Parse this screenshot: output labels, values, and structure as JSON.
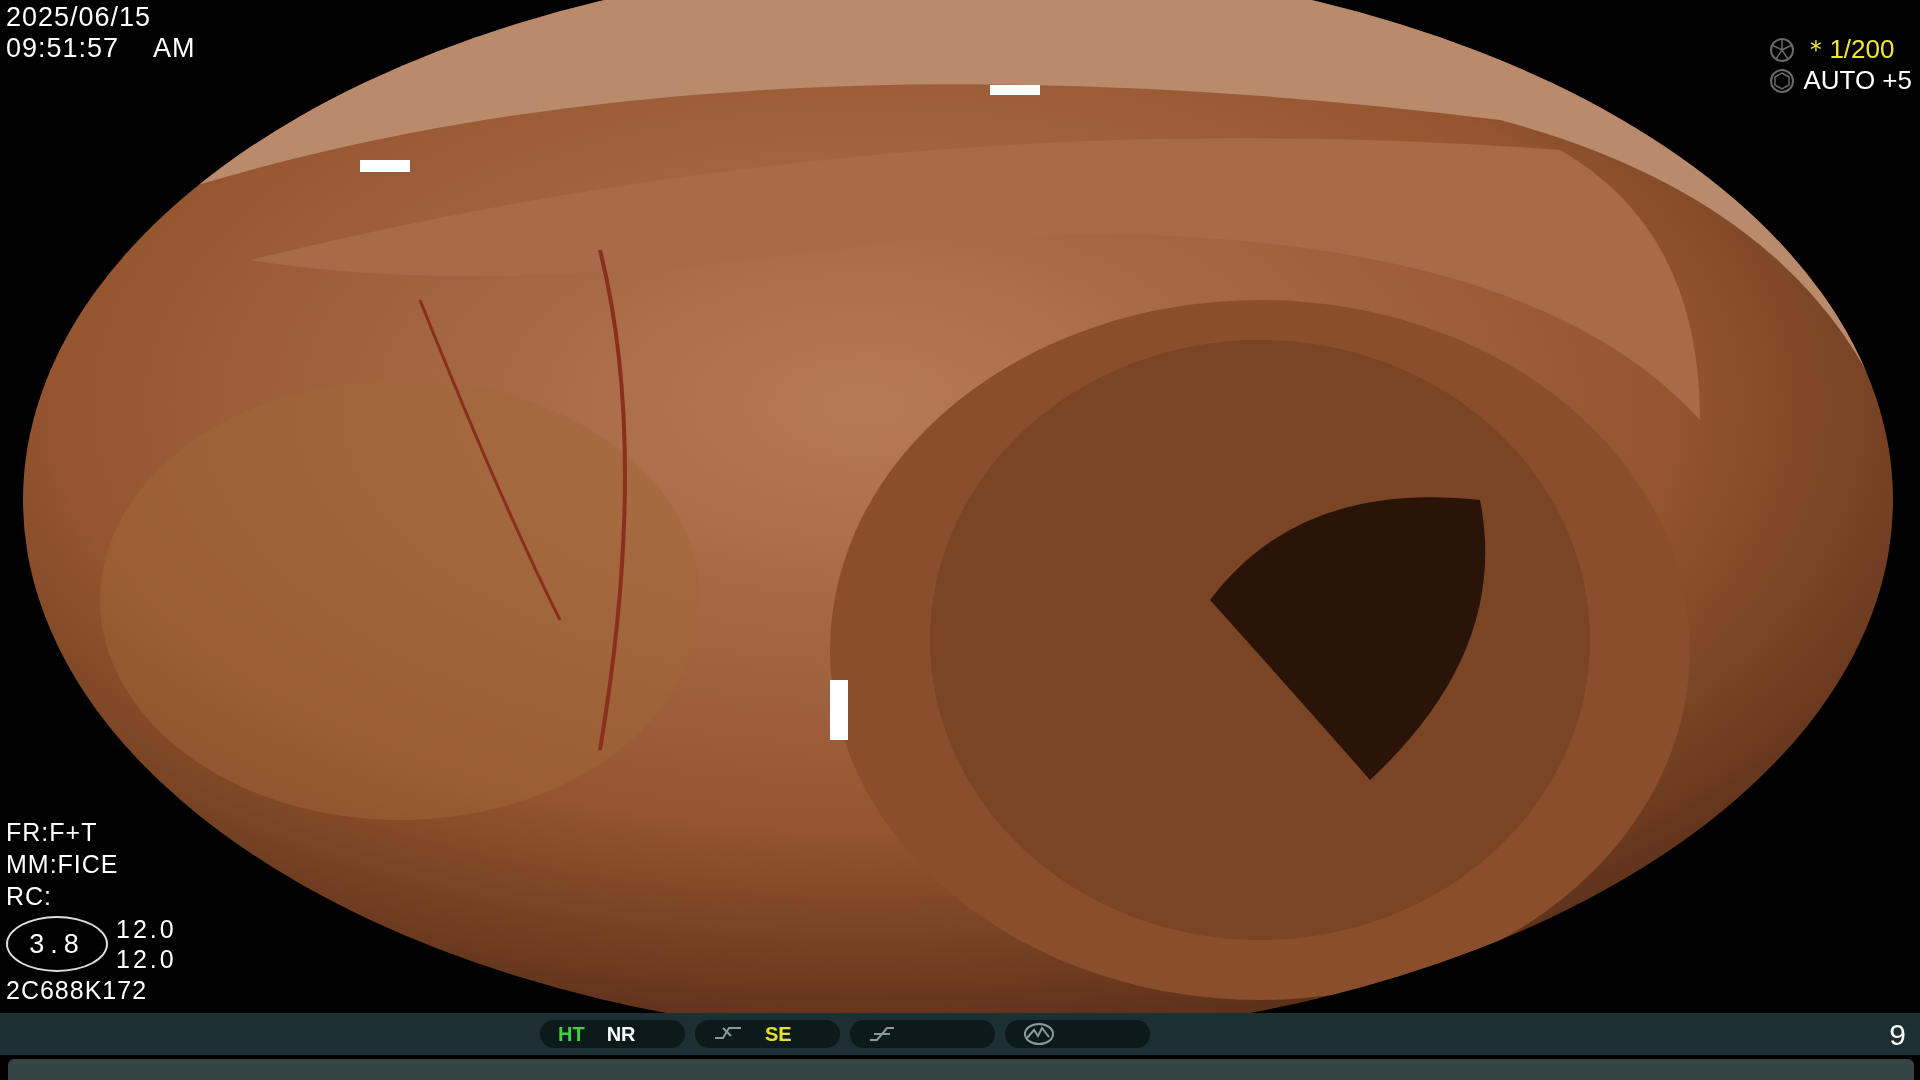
{
  "top_left": {
    "date": "2025/06/15",
    "time": "09:51:57",
    "meridiem": "AM"
  },
  "top_right": {
    "shutter_mark": "＊",
    "shutter": "1/200",
    "exposure": "AUTO +5"
  },
  "bottom_left": {
    "lines": [
      "FR:F+T",
      "MM:FICE",
      "RC:"
    ],
    "oval_value": "3.8",
    "readings": [
      "12.0",
      "12.0"
    ],
    "serial": "2C688K172"
  },
  "status_bar": {
    "groups": [
      {
        "kind": "plain",
        "items": [
          {
            "label": "HT",
            "color": "#3fd13f"
          },
          {
            "label": "NR",
            "color": "#ffffff"
          }
        ]
      },
      {
        "kind": "curve",
        "items": [
          {
            "label": "SE",
            "color": "#e8e030"
          }
        ]
      },
      {
        "kind": "ramp"
      },
      {
        "kind": "wave"
      }
    ],
    "page": "9"
  }
}
